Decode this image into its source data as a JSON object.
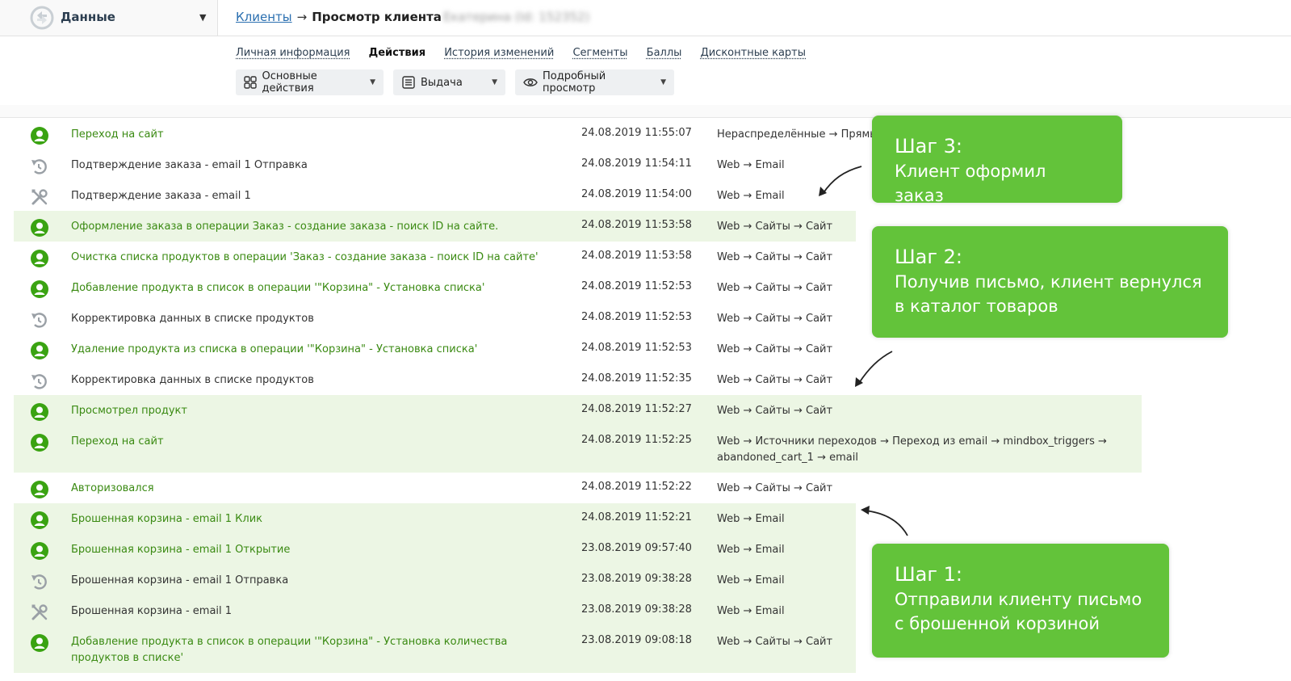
{
  "topbar": {
    "datasource": "Данные",
    "breadcrumb_link": "Клиенты",
    "breadcrumb_arrow": "→",
    "breadcrumb_current": "Просмотр клиента",
    "breadcrumb_blurred": "Екатерина (Id: 152352)"
  },
  "tabs": [
    "Личная информация",
    "Действия",
    "История изменений",
    "Сегменты",
    "Баллы",
    "Дисконтные карты"
  ],
  "toolbar": {
    "main_actions": "Основные действия",
    "output": "Выдача",
    "detailed_view": "Подробный просмотр"
  },
  "rows": [
    {
      "title": "Переход на сайт",
      "date": "24.08.2019 11:55:07",
      "channel": "Нераспределённые → Прямые",
      "icon": "user-icon"
    },
    {
      "title": "Подтверждение заказа - email 1 Отправка",
      "date": "24.08.2019 11:54:11",
      "channel": "Web → Email",
      "icon": "sync-icon"
    },
    {
      "title": "Подтверждение заказа - email 1",
      "date": "24.08.2019 11:54:00",
      "channel": "Web → Email",
      "icon": "tools-icon"
    },
    {
      "title": "Оформление заказа в операции Заказ - создание заказа - поиск ID на сайте.",
      "date": "24.08.2019 11:53:58",
      "channel": "Web → Сайты → Сайт",
      "icon": "user-icon"
    },
    {
      "title": "Очистка списка продуктов в операции 'Заказ - создание заказа - поиск ID на сайте'",
      "date": "24.08.2019 11:53:58",
      "channel": "Web → Сайты → Сайт",
      "icon": "user-icon"
    },
    {
      "title": "Добавление продукта в список в операции '\"Корзина\" - Установка списка'",
      "date": "24.08.2019 11:52:53",
      "channel": "Web → Сайты → Сайт",
      "icon": "user-icon"
    },
    {
      "title": "Корректировка данных в списке продуктов",
      "date": "24.08.2019 11:52:53",
      "channel": "Web → Сайты → Сайт",
      "icon": "sync-icon"
    },
    {
      "title": "Удаление продукта из списка в операции '\"Корзина\" - Установка списка'",
      "date": "24.08.2019 11:52:53",
      "channel": "Web → Сайты → Сайт",
      "icon": "user-icon"
    },
    {
      "title": "Корректировка данных в списке продуктов",
      "date": "24.08.2019 11:52:35",
      "channel": "Web → Сайты → Сайт",
      "icon": "sync-icon"
    },
    {
      "title": "Просмотрел продукт",
      "date": "24.08.2019 11:52:27",
      "channel": "Web → Сайты → Сайт",
      "icon": "user-icon"
    },
    {
      "title": "Переход на сайт",
      "date": "24.08.2019 11:52:25",
      "channel": "Web → Источники переходов → Переход из email → mindbox_triggers → abandoned_cart_1 → email",
      "icon": "user-icon"
    },
    {
      "title": "Авторизовался",
      "date": "24.08.2019 11:52:22",
      "channel": "Web → Сайты → Сайт",
      "icon": "user-icon"
    },
    {
      "title": "Брошенная корзина - email 1 Клик",
      "date": "24.08.2019 11:52:21",
      "channel": "Web → Email",
      "icon": "user-icon"
    },
    {
      "title": "Брошенная корзина - email 1 Открытие",
      "date": "23.08.2019 09:57:40",
      "channel": "Web → Email",
      "icon": "user-icon"
    },
    {
      "title": "Брошенная корзина - email 1 Отправка",
      "date": "23.08.2019 09:38:28",
      "channel": "Web → Email",
      "icon": "sync-icon"
    },
    {
      "title": "Брошенная корзина - email 1",
      "date": "23.08.2019 09:38:28",
      "channel": "Web → Email",
      "icon": "tools-icon"
    },
    {
      "title": "Добавление продукта в список в операции '\"Корзина\" - Установка количества продуктов в списке'",
      "date": "23.08.2019 09:08:18",
      "channel": "Web → Сайты → Сайт",
      "icon": "user-icon"
    }
  ],
  "callouts": [
    {
      "title": "Шаг 3:",
      "text": "Клиент оформил заказ"
    },
    {
      "title": "Шаг 2:",
      "text": "Получив письмо, клиент вернулся в каталог товаров"
    },
    {
      "title": "Шаг 1:",
      "text": "Отправили клиенту письмо с брошенной корзиной"
    }
  ],
  "colors": {
    "accent_green": "#63c33a",
    "text_green": "#3a8a12",
    "row_highlight": "#ecf6e4",
    "link_blue": "#2a6fb0"
  }
}
